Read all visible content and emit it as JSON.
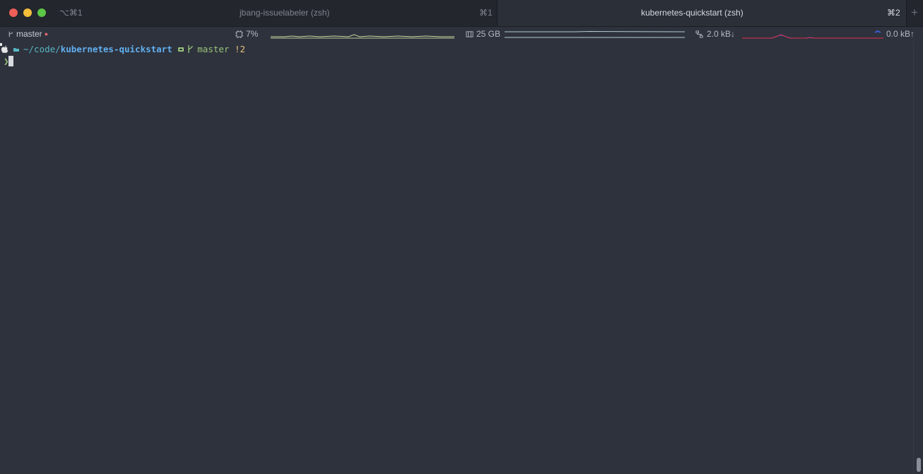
{
  "window": {
    "tabs": [
      {
        "title": "jbang-issuelabeler (zsh)",
        "shortcut": "⌘1",
        "active": false
      },
      {
        "title": "kubernetes-quickstart (zsh)",
        "shortcut": "⌘2",
        "active": true
      }
    ],
    "tab_hotkey": "⌥⌘1",
    "new_tab_label": "+"
  },
  "statusbar": {
    "branch": "master",
    "branch_dirty_marker": "●",
    "cpu": "7%",
    "memory": "25 GB",
    "net_down": "2.0 kB↓",
    "net_up": "0.0 kB↑"
  },
  "terminal": {
    "prompt_path_prefix": "~/code/",
    "prompt_path_dir": "kubernetes-quickstart",
    "git_branch": "master",
    "git_status": "!2",
    "prompt_char": "❯"
  },
  "colors": {
    "background": "#2e323d",
    "tabbar": "#23262d",
    "accent_path": "#61afef",
    "accent_git": "#98c379",
    "accent_dirty": "#e5c07b",
    "net_down_line": "#e0304a",
    "net_up_line": "#3a5ccf",
    "cpu_line": "#c8d9a0",
    "mem_line": "#b4c9d0"
  },
  "icons": {
    "folder": "folder-icon",
    "git": "git-branch-icon",
    "apple": "apple-icon",
    "cpu": "cpu-chip-icon",
    "memory": "memory-icon",
    "network": "network-icon"
  }
}
